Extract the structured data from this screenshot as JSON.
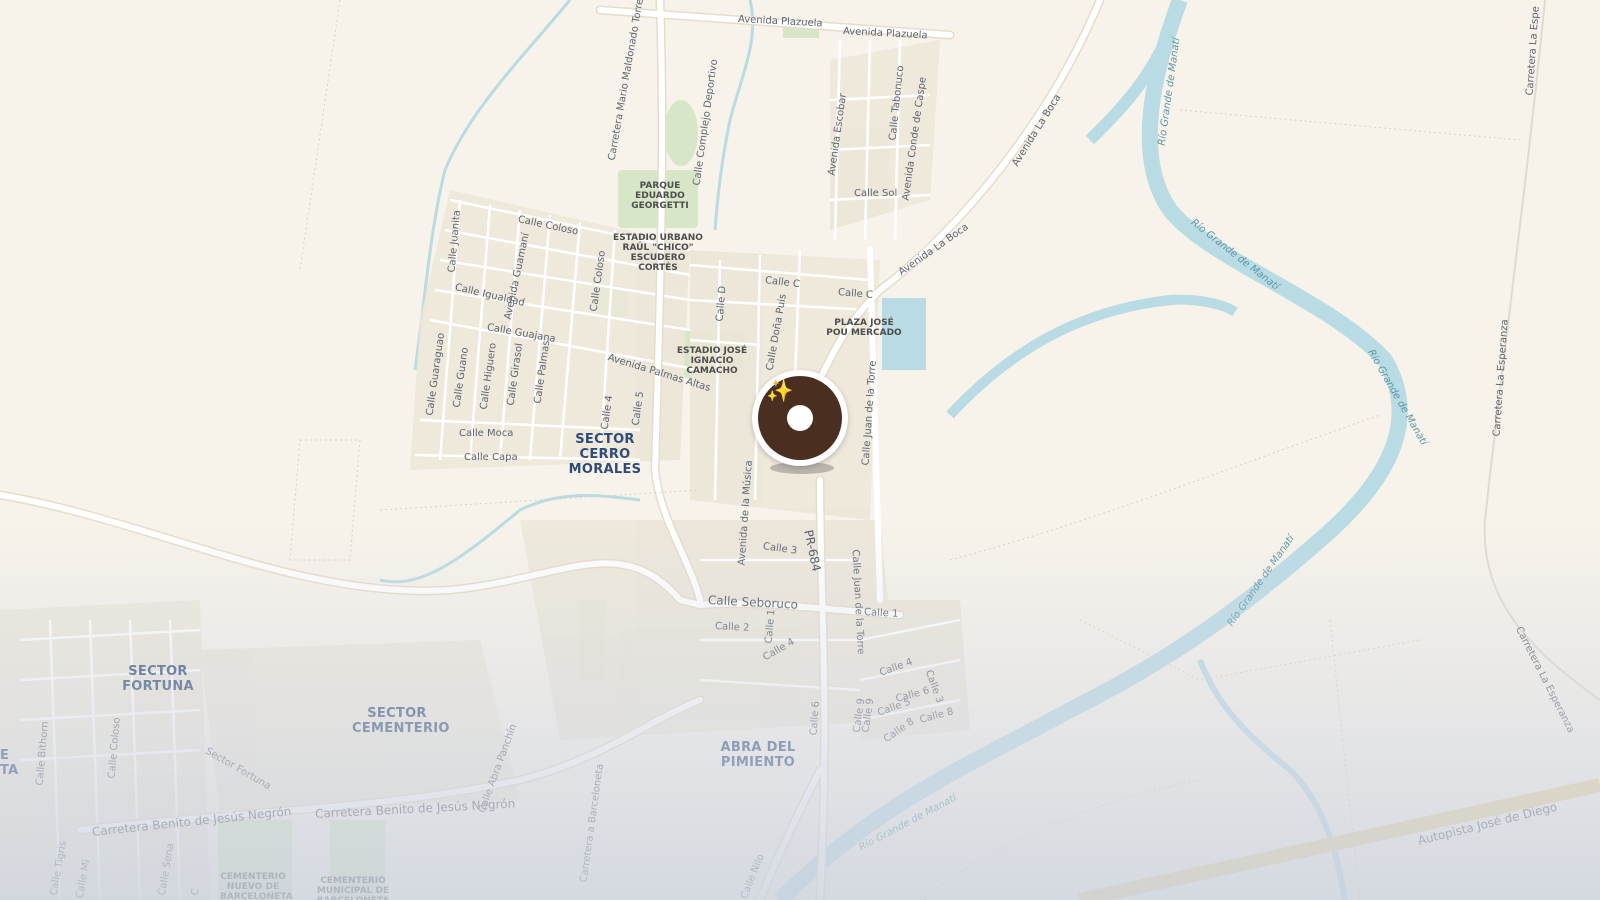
{
  "map": {
    "colors": {
      "land": "#f7f3ea",
      "road": "#ffffff",
      "road_casing": "#e6ddc9",
      "highway": "#e9d49a",
      "water": "#b9dbe4",
      "park": "#d8e6c8",
      "block": "#ece6d8",
      "pin": "#4a2e1f",
      "sector_text": "#2f4b7a"
    },
    "sectors": [
      {
        "name": "SECTOR CERRO MORALES"
      },
      {
        "name": "SECTOR FORTUNA"
      },
      {
        "name": "SECTOR CEMENTERIO"
      },
      {
        "name": "ABRA DEL PIMIENTO"
      },
      {
        "name": "E\nTA"
      }
    ],
    "pois": [
      {
        "name": "PARQUE EDUARDO GEORGETTI"
      },
      {
        "name": "ESTADIO URBANO RAÚL \"CHICO\" ESCUDERO CORTÉS"
      },
      {
        "name": "ESTADIO JOSÉ IGNACIO CAMACHO"
      },
      {
        "name": "PLAZA JOSÉ POU MERCADO"
      },
      {
        "name": "CEMENTERIO NUEVO DE BARCELONETA"
      },
      {
        "name": "CEMENTERIO MUNICIPAL DE BARCELONETA"
      }
    ],
    "streets": [
      "Avenida Plazuela",
      "Avenida Plazuela",
      "Carretera Mario Maldonado Torres",
      "Calle Complejo Deportivo",
      "Avenida Escobar",
      "Calle Tabonuco",
      "Avenida Conde de Caspe",
      "Calle Sol",
      "Avenida La Boca",
      "Avenida La Boca",
      "Calle Coloso",
      "Calle Juanita",
      "Avenida Guamaní",
      "Calle Coloso",
      "Calle Igualdad",
      "Calle Guajana",
      "Avenida Palmas Altas",
      "Calle C",
      "Calle C",
      "Calle D",
      "Calle Doña Puis",
      "Calle Guaraguao",
      "Calle Guano",
      "Calle Higuero",
      "Calle Girasol",
      "Calle Palmas",
      "Calle 4",
      "Calle 5",
      "Calle Moca",
      "Calle Capa",
      "Calle Juan de la Torre",
      "Calle Juan de la Torre",
      "Avenida de la Música",
      "PR-684",
      "Calle 3",
      "Calle Seboruco",
      "Calle 2",
      "Calle 1",
      "Calle 4",
      "Calle 1",
      "Calle 3",
      "Calle 4",
      "Calle 5",
      "Calle 6",
      "Calle 8",
      "Calle 9",
      "Calle 9",
      "Calle 6",
      "Calle 8",
      "Calle Bithorn",
      "Calle Coloso",
      "Sector Fortuna",
      "Carretera Benito de Jesús Negrón",
      "Carretera Benito de Jesús Negrón",
      "Calle Abra Panchín",
      "Carretera a Barceloneta",
      "Calle Nilo",
      "Calle Tigris",
      "Calle Sena",
      "Calle Mi",
      "C",
      "Autopista José de Diego",
      "Carretera La Esperanza",
      "Carretera La Esperanza",
      "Carretera La Espe"
    ],
    "rivers": [
      "Río Grande de Manatí",
      "Río Grande de Manatí",
      "Río Grande de Manatí",
      "Río Grande de Manatí",
      "Río Grande de Manatí"
    ],
    "marker": {
      "icon": "sparkle-donut-icon",
      "glyph": "✨"
    }
  }
}
